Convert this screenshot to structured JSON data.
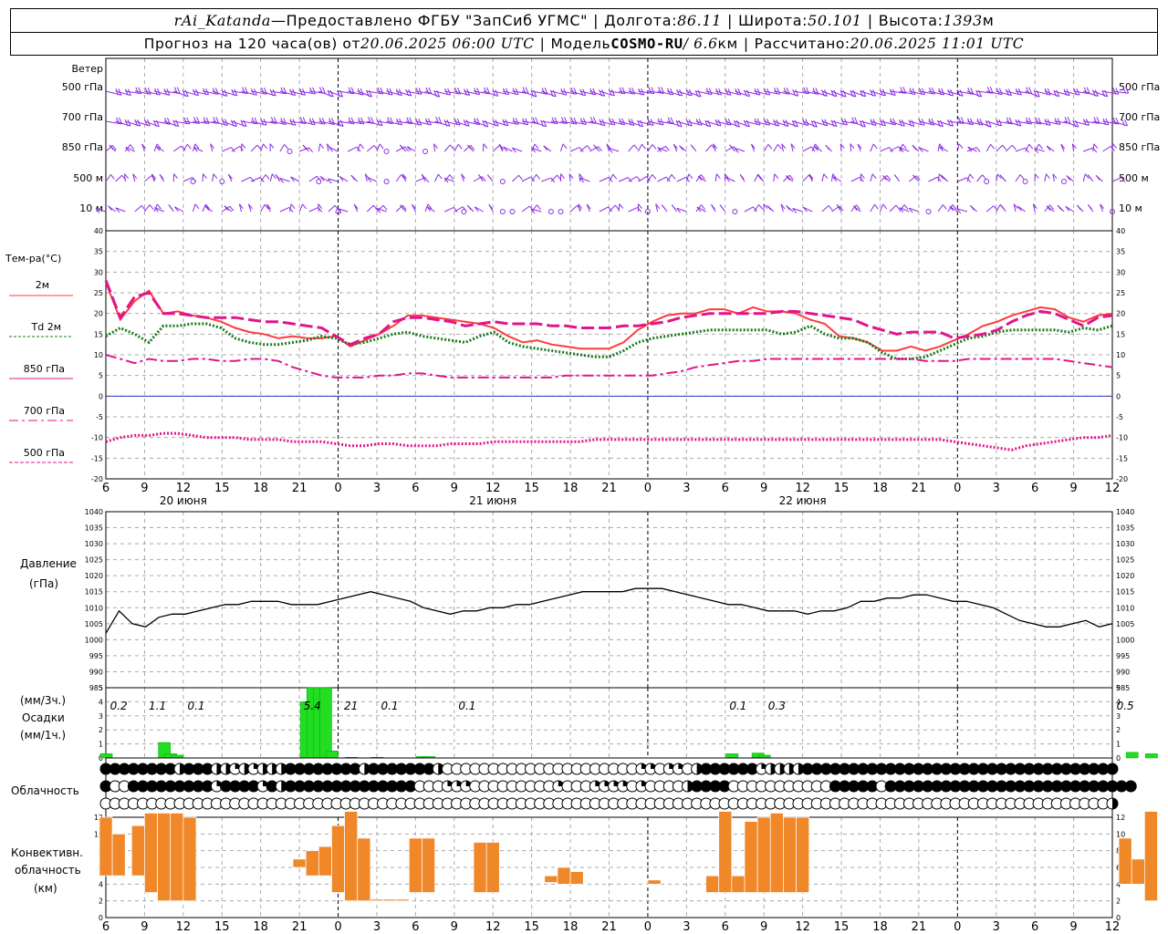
{
  "header": {
    "station": "rAi_Katanda",
    "dash": " — ",
    "provided_by": "Предоставлено ФГБУ \"ЗапСиб УГМС\"",
    "lon_label": "Долгота: ",
    "lon": "86.11",
    "lat_label": "Широта: ",
    "lat": "50.101",
    "alt_label": "Высота: ",
    "alt": "1393",
    "alt_unit": "м",
    "forecast_prefix": "Прогноз на 120 часа(ов) от ",
    "forecast_from": "20.06.2025 06:00 UTC",
    "model_label": "Модель ",
    "model": "COSMO-RU",
    "model_res": " / 6.6",
    "model_res_unit": "км",
    "calc_label": "Рассчитано: ",
    "calc_time": "20.06.2025 11:01 UTC"
  },
  "colors": {
    "wind": "#8a2be2",
    "t2m": "#ff3b3b",
    "td": "#1a7a1a",
    "t850": "#e0158c",
    "t700": "#e0158c",
    "t500": "#e0158c",
    "pressure": "#000000",
    "precip": "#22dd22",
    "convective": "#f0882a",
    "zero_line": "#3333cc"
  },
  "panels": {
    "wind_title": "Ветер",
    "wind_levels": [
      "500 гПа",
      "700 гПа",
      "850 гПа",
      "500  м",
      "10   м"
    ],
    "temp_title": "Тем-ра(°C)",
    "temp_legend": [
      {
        "id": "t2m",
        "label": "2м"
      },
      {
        "id": "td",
        "label": "Td  2м",
        "prefix": "Td"
      },
      {
        "id": "t850",
        "label": "850 гПа"
      },
      {
        "id": "t700",
        "label": "700 гПа"
      },
      {
        "id": "t500",
        "label": "500 гПа"
      }
    ],
    "pressure_title": "Давление",
    "pressure_unit": "(гПа)",
    "precip_unit_top": "(мм/3ч.)",
    "precip_title": "Осадки",
    "precip_unit_bottom": "(мм/1ч.)",
    "cloud_title": "Облачность",
    "conv_title_1": "Конвективн.",
    "conv_title_2": "облачность",
    "conv_unit": "(км)"
  },
  "axes": {
    "hour_ticks": [
      "6",
      "9",
      "12",
      "15",
      "18",
      "21",
      "0",
      "3",
      "6",
      "9",
      "12",
      "15",
      "18",
      "21",
      "0",
      "3",
      "6",
      "9",
      "12",
      "15",
      "18",
      "21",
      "0",
      "3",
      "6",
      "9",
      "12"
    ],
    "day_labels": [
      {
        "label": "20 июня",
        "hour_offset": 6
      },
      {
        "label": "21 июня",
        "hour_offset": 30
      },
      {
        "label": "22 июня",
        "hour_offset": 54
      }
    ],
    "temp_ticks": [
      "40",
      "35",
      "30",
      "25",
      "20",
      "15",
      "10",
      "5",
      "0",
      "-5",
      "-10",
      "-15",
      "-20"
    ],
    "pressure_ticks": [
      "1040",
      "1035",
      "1030",
      "1025",
      "1020",
      "1015",
      "1010",
      "1005",
      "1000",
      "995",
      "990",
      "985"
    ],
    "precip_ticks": [
      "5",
      "4",
      "3",
      "2",
      "1",
      "0"
    ],
    "conv_ticks": [
      "12",
      "10",
      "8",
      "6",
      "4",
      "2",
      "0"
    ]
  },
  "chart_data": [
    {
      "type": "line",
      "name": "temperature",
      "x_hours": [
        0,
        1,
        2,
        3,
        4,
        5,
        6,
        7,
        8,
        9,
        10,
        11,
        12,
        13,
        14,
        15,
        16,
        17,
        18,
        19,
        20,
        21,
        22,
        23,
        24,
        25,
        26,
        27,
        28,
        29,
        30,
        31,
        32,
        33,
        34,
        35,
        36,
        37,
        38,
        39,
        40,
        41,
        42,
        43,
        44,
        45,
        46,
        47,
        48,
        49,
        50,
        51,
        52,
        53,
        54,
        55,
        56,
        57,
        58,
        59,
        60,
        61,
        62,
        63,
        64,
        65,
        66,
        67,
        68,
        69,
        70,
        71,
        72,
        73,
        74,
        75,
        76,
        77,
        78,
        79,
        80,
        81,
        82
      ],
      "ylim": [
        -20,
        40
      ],
      "series": [
        {
          "name": "2м",
          "style": "solid",
          "values": [
            27.5,
            18.5,
            23,
            25.5,
            20,
            20.5,
            19.5,
            19,
            18,
            16.5,
            15.5,
            15,
            14,
            14.5,
            14,
            14,
            14.5,
            12,
            13.5,
            15,
            17,
            19.5,
            19.5,
            19,
            18.5,
            18,
            17.5,
            16.5,
            14.5,
            13,
            13.5,
            12.5,
            12,
            11.5,
            11.5,
            11.5,
            13,
            16,
            18,
            19.5,
            20,
            20,
            21,
            21,
            20,
            21.5,
            20.5,
            20.5,
            20,
            18.5,
            17.5,
            14.5,
            14,
            13,
            11,
            11,
            12,
            11,
            12,
            13.5,
            15,
            17,
            18,
            19.5,
            20.5,
            21.5,
            21,
            19,
            18,
            19.5,
            20
          ]
        },
        {
          "name": "Td  2м",
          "style": "dotted",
          "values": [
            14.5,
            16.5,
            15,
            13,
            17,
            17,
            17.5,
            17.5,
            16.5,
            14,
            13,
            12.5,
            12.5,
            13,
            13.5,
            14.5,
            14,
            12.5,
            13,
            14,
            15,
            15.5,
            14.5,
            14,
            13.5,
            13,
            14.5,
            15.5,
            13,
            12,
            11.5,
            11,
            10.5,
            10,
            9.5,
            9.5,
            11,
            13,
            14,
            14.5,
            15,
            15.5,
            16,
            16,
            16,
            16,
            16,
            15,
            15.5,
            17,
            15,
            14,
            14,
            13,
            10.5,
            9,
            9,
            9.5,
            11,
            12.5,
            14,
            14.5,
            15.5,
            16,
            16,
            16,
            16,
            15.5,
            16.5,
            16,
            17
          ]
        },
        {
          "name": "850 гПа",
          "style": "dash",
          "values": [
            28,
            19,
            24,
            25,
            20,
            20,
            19.5,
            19,
            19,
            19,
            18.5,
            18,
            18,
            17.5,
            17,
            16.5,
            14.5,
            12.5,
            14,
            15,
            18,
            19,
            19,
            18.5,
            18,
            17,
            17.5,
            18,
            17.5,
            17.5,
            17.5,
            17,
            17,
            16.5,
            16.5,
            16.5,
            17,
            17,
            17.5,
            18,
            19,
            19.5,
            20,
            20,
            20,
            20,
            20,
            20.5,
            20.5,
            20,
            19.5,
            19,
            18.5,
            17,
            16,
            15,
            15.5,
            15.5,
            15.5,
            14,
            14.5,
            15,
            16,
            18,
            19.5,
            20.5,
            20,
            18.5,
            17,
            19,
            19.5
          ]
        },
        {
          "name": "700 гПа",
          "style": "dashdot",
          "values": [
            10,
            9,
            8,
            9,
            8.5,
            8.5,
            9,
            9,
            8.5,
            8.5,
            9,
            9,
            8.5,
            7,
            6,
            5,
            4.5,
            4.5,
            4.5,
            5,
            5,
            5.5,
            5.5,
            5,
            4.5,
            4.5,
            4.5,
            4.5,
            4.5,
            4.5,
            4.5,
            4.5,
            5,
            5,
            5,
            5,
            5,
            5,
            5,
            5.5,
            6,
            7,
            7.5,
            8,
            8.5,
            8.5,
            9,
            9,
            9,
            9,
            9,
            9,
            9,
            9,
            9,
            9,
            9,
            8.5,
            8.5,
            8.5,
            9,
            9,
            9,
            9,
            9,
            9,
            9,
            8.5,
            8,
            7.5,
            7
          ]
        },
        {
          "name": "500 гПа",
          "style": "dotted",
          "values": [
            -11,
            -10,
            -9.5,
            -9.5,
            -9,
            -9,
            -9.5,
            -10,
            -10,
            -10,
            -10.5,
            -10.5,
            -10.5,
            -11,
            -11,
            -11,
            -11.5,
            -12,
            -12,
            -11.5,
            -11.5,
            -12,
            -12,
            -12,
            -11.5,
            -11.5,
            -11.5,
            -11,
            -11,
            -11,
            -11,
            -11,
            -11,
            -11,
            -10.5,
            -10.5,
            -10.5,
            -10.5,
            -10.5,
            -10.5,
            -10.5,
            -10.5,
            -10.5,
            -10.5,
            -10.5,
            -10.5,
            -10.5,
            -10.5,
            -10.5,
            -10.5,
            -10.5,
            -10.5,
            -10.5,
            -10.5,
            -10.5,
            -10.5,
            -10.5,
            -10.5,
            -10.5,
            -11,
            -11.5,
            -12,
            -12.5,
            -13,
            -12,
            -11.5,
            -11,
            -10.5,
            -10,
            -10,
            -9.5
          ]
        }
      ]
    },
    {
      "type": "line",
      "name": "pressure",
      "ylim": [
        985,
        1040
      ],
      "x_hours": [
        0,
        1,
        2,
        3,
        4,
        5,
        6,
        7,
        8,
        9,
        10,
        11,
        12,
        13,
        14,
        15,
        16,
        17,
        18,
        19,
        20,
        21,
        22,
        23,
        24,
        25,
        26,
        27,
        28,
        29,
        30,
        31,
        32,
        33,
        34,
        35,
        36,
        37,
        38,
        39,
        40,
        41,
        42,
        43,
        44,
        45,
        46,
        47,
        48,
        49,
        50,
        51,
        52,
        53,
        54,
        55,
        56,
        57,
        58,
        59,
        60,
        61,
        62,
        63,
        64,
        65,
        66,
        67,
        68,
        69,
        70
      ],
      "series": [
        {
          "name": "",
          "values": [
            1002,
            1009,
            1005,
            1004,
            1007,
            1008,
            1008,
            1009,
            1010,
            1011,
            1011,
            1012,
            1012,
            1012,
            1011,
            1011,
            1011,
            1012,
            1013,
            1014,
            1015,
            1014,
            1013,
            1012,
            1010,
            1009,
            1008,
            1009,
            1009,
            1010,
            1010,
            1011,
            1011,
            1012,
            1013,
            1014,
            1015,
            1015,
            1015,
            1015,
            1016,
            1016,
            1016,
            1015,
            1014,
            1013,
            1012,
            1011,
            1011,
            1010,
            1009,
            1009,
            1009,
            1008,
            1009,
            1009,
            1010,
            1012,
            1012,
            1013,
            1013,
            1014,
            1014,
            1013,
            1012,
            1012,
            1011,
            1010,
            1008,
            1006,
            1005,
            1004,
            1004,
            1005,
            1006,
            1004,
            1005
          ]
        }
      ]
    },
    {
      "type": "bar",
      "name": "precipitation",
      "ylim": [
        0,
        5
      ],
      "bars_1h": [
        [
          0,
          0.3
        ],
        [
          4.5,
          1.1
        ],
        [
          5,
          0.3
        ],
        [
          5.5,
          0.2
        ],
        [
          15.5,
          4.0
        ],
        [
          16,
          5.4
        ],
        [
          16.5,
          5.0
        ],
        [
          17,
          5.0
        ],
        [
          17.5,
          0.5
        ],
        [
          19,
          0.05
        ],
        [
          21,
          0.05
        ],
        [
          24.5,
          0.1
        ],
        [
          25,
          0.1
        ],
        [
          48.5,
          0.3
        ],
        [
          50.5,
          0.35
        ],
        [
          51,
          0.2
        ],
        [
          79.5,
          0.4
        ],
        [
          81,
          0.3
        ]
      ],
      "labels_3h": [
        {
          "hour": 1,
          "text": "0.2"
        },
        {
          "hour": 4,
          "text": "1.1"
        },
        {
          "hour": 7,
          "text": "0.1"
        },
        {
          "hour": 16,
          "text": "5.4"
        },
        {
          "hour": 19,
          "text": "21"
        },
        {
          "hour": 22,
          "text": "0.1"
        },
        {
          "hour": 28,
          "text": "0.1"
        },
        {
          "hour": 49,
          "text": "0.1"
        },
        {
          "hour": 52,
          "text": "0.3"
        },
        {
          "hour": 79,
          "text": "0.5"
        }
      ]
    },
    {
      "type": "table",
      "name": "cloud-cover",
      "rows": [
        "ffffffffhfffhhqhqhhhffffffffhfffffffhoooooooooooooooooooooqqoqqohffffffqhhhhffffffffffffffffffffffffffffffffff",
        "foofffffffffqffffqfhffffffffffffffoooqqqoooooooooqoooqqqqoqoooohffffooooooooooofffffofffffffffffffffffffffffffff",
        "oooooooooooooooooooooooooooooooooooooooooooooooooooooooooooooooooooooooooooooooooooooooooooooooooooooooooooooh"
      ]
    },
    {
      "type": "bar",
      "name": "convective-cloud",
      "ylim": [
        0,
        13
      ],
      "bars": [
        [
          0,
          5,
          12
        ],
        [
          1,
          5,
          10
        ],
        [
          2.5,
          5,
          11
        ],
        [
          3.5,
          3,
          12.5
        ],
        [
          4.5,
          2,
          12.5
        ],
        [
          5.5,
          2,
          12.5
        ],
        [
          6.5,
          2,
          12
        ],
        [
          15,
          6,
          7
        ],
        [
          16,
          5,
          8
        ],
        [
          17,
          5,
          8.5
        ],
        [
          18,
          3,
          11
        ],
        [
          19,
          2,
          13
        ],
        [
          20,
          2,
          9.5
        ],
        [
          21,
          2,
          2.2
        ],
        [
          22,
          2,
          2.2
        ],
        [
          23,
          2,
          2.2
        ],
        [
          24,
          3,
          9.5
        ],
        [
          25,
          3,
          9.5
        ],
        [
          29,
          3,
          9
        ],
        [
          30,
          3,
          9
        ],
        [
          34.5,
          4.2,
          5
        ],
        [
          35.5,
          4,
          6
        ],
        [
          36.5,
          4,
          5.5
        ],
        [
          42.5,
          4,
          4.5
        ],
        [
          47,
          3,
          5
        ],
        [
          48,
          3,
          13
        ],
        [
          49,
          3,
          5
        ],
        [
          50,
          3,
          11.5
        ],
        [
          51,
          3,
          12
        ],
        [
          52,
          3,
          12.5
        ],
        [
          53,
          3,
          12
        ],
        [
          54,
          3,
          12
        ],
        [
          79,
          4,
          9.5
        ],
        [
          80,
          4,
          7
        ],
        [
          81,
          2,
          13
        ]
      ]
    },
    {
      "type": "scatter",
      "name": "wind",
      "levels": [
        "500 гПа",
        "700 гПа",
        "850 гПа",
        "500  м",
        "10   м"
      ]
    }
  ]
}
